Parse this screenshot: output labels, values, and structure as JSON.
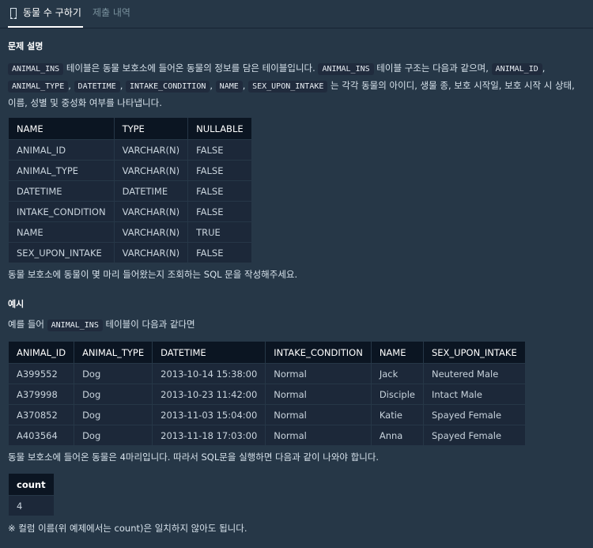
{
  "tabs": {
    "active_label": "동물 수 구하기",
    "inactive_label": "제출 내역"
  },
  "description": {
    "heading": "문제 설명",
    "p1_codes": [
      "ANIMAL_INS",
      "ANIMAL_INS",
      "ANIMAL_ID",
      "ANIMAL_TYPE",
      "DATETIME",
      "INTAKE_CONDITION",
      "NAME",
      "SEX_UPON_INTAKE"
    ],
    "p1_text": {
      "a": " 테이블은 동물 보호소에 들어온 동물의 정보를 담은 테이블입니다. ",
      "b": " 테이블 구조는 다음과 같으며, ",
      "sep": ", ",
      "c": " 는 각각 동물의 아이디, 생물 종, 보호 시작일, 보호 시작 시 상태, 이름, 성별 및 중성화 여부를 나타냅니다."
    },
    "schema": {
      "headers": [
        "NAME",
        "TYPE",
        "NULLABLE"
      ],
      "rows": [
        [
          "ANIMAL_ID",
          "VARCHAR(N)",
          "FALSE"
        ],
        [
          "ANIMAL_TYPE",
          "VARCHAR(N)",
          "FALSE"
        ],
        [
          "DATETIME",
          "DATETIME",
          "FALSE"
        ],
        [
          "INTAKE_CONDITION",
          "VARCHAR(N)",
          "FALSE"
        ],
        [
          "NAME",
          "VARCHAR(N)",
          "TRUE"
        ],
        [
          "SEX_UPON_INTAKE",
          "VARCHAR(N)",
          "FALSE"
        ]
      ]
    },
    "task": "동물 보호소에 동물이 몇 마리 들어왔는지 조회하는 SQL 문을 작성해주세요."
  },
  "example": {
    "heading": "예시",
    "intro_a": "예를 들어 ",
    "intro_code": "ANIMAL_INS",
    "intro_b": " 테이블이 다음과 같다면",
    "table": {
      "headers": [
        "ANIMAL_ID",
        "ANIMAL_TYPE",
        "DATETIME",
        "INTAKE_CONDITION",
        "NAME",
        "SEX_UPON_INTAKE"
      ],
      "rows": [
        [
          "A399552",
          "Dog",
          "2013-10-14 15:38:00",
          "Normal",
          "Jack",
          "Neutered Male"
        ],
        [
          "A379998",
          "Dog",
          "2013-10-23 11:42:00",
          "Normal",
          "Disciple",
          "Intact Male"
        ],
        [
          "A370852",
          "Dog",
          "2013-11-03 15:04:00",
          "Normal",
          "Katie",
          "Spayed Female"
        ],
        [
          "A403564",
          "Dog",
          "2013-11-18 17:03:00",
          "Normal",
          "Anna",
          "Spayed Female"
        ]
      ]
    },
    "result_text": "동물 보호소에 들어온 동물은 4마리입니다. 따라서 SQL문을 실행하면 다음과 같이 나와야 합니다.",
    "result": {
      "header": "count",
      "value": "4"
    },
    "note": "※ 컬럼 이름(위 예제에서는 count)은 일치하지 않아도 됩니다."
  },
  "colors": {
    "background": "#263747",
    "table_header": "#0b1522",
    "table_cell": "#1c2839",
    "code_bg": "#202b3d"
  }
}
